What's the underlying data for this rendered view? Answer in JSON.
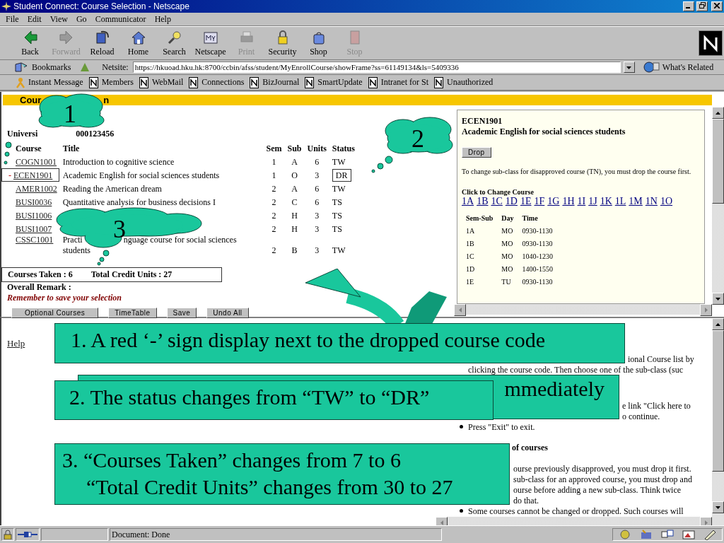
{
  "window": {
    "title": "Student Connect: Course Selection - Netscape"
  },
  "menu": [
    "File",
    "Edit",
    "View",
    "Go",
    "Communicator",
    "Help"
  ],
  "toolbar": [
    {
      "label": "Back",
      "disabled": false
    },
    {
      "label": "Forward",
      "disabled": true
    },
    {
      "label": "Reload",
      "disabled": false
    },
    {
      "label": "Home",
      "disabled": false
    },
    {
      "label": "Search",
      "disabled": false
    },
    {
      "label": "Netscape",
      "disabled": false
    },
    {
      "label": "Print",
      "disabled": true
    },
    {
      "label": "Security",
      "disabled": false
    },
    {
      "label": "Shop",
      "disabled": false
    },
    {
      "label": "Stop",
      "disabled": true
    }
  ],
  "location": {
    "bookmarks": "Bookmarks",
    "label": "Netsite:",
    "url": "https://hkuoad.hku.hk:8700/ccbin/afss/student/MyEnrollCourse/showFrame?ss=61149134&ls=5409336",
    "related": "What's Related"
  },
  "personal_toolbar": [
    {
      "label": "Instant Message",
      "kind": "person"
    },
    {
      "label": "Members",
      "kind": "page"
    },
    {
      "label": "WebMail",
      "kind": "page"
    },
    {
      "label": "Connections",
      "kind": "page"
    },
    {
      "label": "BizJournal",
      "kind": "page"
    },
    {
      "label": "SmartUpdate",
      "kind": "page"
    },
    {
      "label": "Intranet for St",
      "kind": "page"
    },
    {
      "label": "Unauthorized",
      "kind": "page"
    }
  ],
  "course_page": {
    "heading_parts": [
      "Cour",
      "n"
    ],
    "student_parts": [
      "Universi",
      "000123456"
    ],
    "columns": [
      "Course",
      "Title",
      "Sem",
      "Sub",
      "Units",
      "Status"
    ],
    "rows": [
      {
        "code": "COGN1001",
        "title": "Introduction to cognitive science",
        "sem": "1",
        "sub": "A",
        "units": "6",
        "status": "TW",
        "dropped": false
      },
      {
        "mark": "-",
        "code": "ECEN1901",
        "title": "Academic English for social sciences students",
        "sem": "1",
        "sub": "O",
        "units": "3",
        "status": "DR",
        "dropped": true
      },
      {
        "code": "AMER1002",
        "title": "Reading the American dream",
        "sem": "2",
        "sub": "A",
        "units": "6",
        "status": "TW",
        "dropped": false
      },
      {
        "code": "BUSI0036",
        "title": "Quantitative analysis for business decisions I",
        "sem": "2",
        "sub": "C",
        "units": "6",
        "status": "TS",
        "dropped": false
      },
      {
        "code": "BUSI1006",
        "sem": "2",
        "sub": "H",
        "units": "3",
        "status": "TS",
        "dropped": false
      },
      {
        "code": "BUSI1007",
        "sem": "2",
        "sub": "H",
        "units": "3",
        "status": "TS",
        "dropped": false
      },
      {
        "code": "CSSC1001",
        "title_parts": [
          "Practi",
          "nguage course for social sciences",
          "students"
        ],
        "sem": "2",
        "sub": "B",
        "units": "3",
        "status": "TW",
        "dropped": false
      }
    ],
    "courses_taken": "Courses Taken : 6",
    "total_units": "Total Credit Units : 27",
    "remark": "Overall Remark :",
    "reminder": "Remember to save your selection",
    "buttons": [
      "Optional Courses",
      "TimeTable",
      "Save",
      "Undo All"
    ]
  },
  "detail_pane": {
    "code": "ECEN1901",
    "title": "Academic English for social sciences students",
    "button": "Drop",
    "note": "To change sub-class for disapproved course (TN), you must drop the course first.",
    "change_label": "Click to Change Course",
    "subclasses": [
      "1A",
      "1B",
      "1C",
      "1D",
      "1E",
      "1F",
      "1G",
      "1H",
      "1I",
      "1J",
      "1K",
      "1L",
      "1M",
      "1N",
      "1O"
    ],
    "columns": [
      "Sem-Sub",
      "Day",
      "Time"
    ],
    "rows": [
      [
        "1A",
        "MO",
        "0930-1130"
      ],
      [
        "1B",
        "MO",
        "0930-1130"
      ],
      [
        "1C",
        "MO",
        "1040-1230"
      ],
      [
        "1D",
        "MO",
        "1400-1550"
      ],
      [
        "1E",
        "TU",
        "0930-1130"
      ]
    ]
  },
  "help_pane": {
    "help": "Help",
    "lines": [
      {
        "kind": "text",
        "text": "ional Course list by"
      },
      {
        "kind": "text",
        "text": "clicking the course code. Then choose one of the sub-class (suc"
      },
      {
        "kind": "text",
        "text": "e link \"Click here to"
      },
      {
        "kind": "text",
        "text": "o continue."
      },
      {
        "kind": "bullet",
        "text": "Press \"Exit\" to exit."
      },
      {
        "kind": "heading",
        "text": "of courses"
      },
      {
        "kind": "text",
        "text": "ourse previously disapproved, you must drop it first."
      },
      {
        "kind": "text",
        "text": "sub-class for an approved course, you must drop and"
      },
      {
        "kind": "text",
        "text": "ourse before adding a new sub-class. Think twice"
      },
      {
        "kind": "text",
        "text": "do that."
      },
      {
        "kind": "bullet",
        "text": "Some courses cannot be changed or dropped. Such courses will"
      }
    ]
  },
  "callouts": [
    "1",
    "2",
    "3"
  ],
  "banners": [
    {
      "lines": [
        "1. A red ‘-’ sign display next to the dropped course code"
      ]
    },
    {
      "behind": "mmediately",
      "lines": [
        "2. The status changes from “TW” to “DR”"
      ]
    },
    {
      "lines": [
        "3. “Courses Taken” changes from 7 to 6",
        "“Total Credit Units” changes from 30 to 27"
      ]
    }
  ],
  "status_bar": {
    "text": "Document: Done"
  }
}
